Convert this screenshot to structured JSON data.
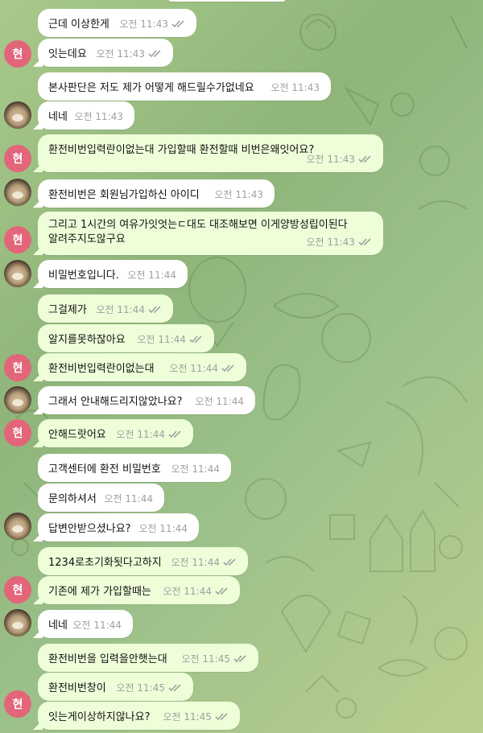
{
  "avatars": {
    "hyun": "현"
  },
  "colors": {
    "outgoing_bubble": "#eefed9",
    "incoming_bubble": "#ffffff",
    "read_check": "#5fa24c",
    "avatar_hyun": "#e2657a"
  },
  "messages": [
    {
      "id": "m1",
      "dir": "in",
      "text": "근데 이상한게",
      "time": "오전 11:43"
    },
    {
      "id": "m2",
      "dir": "in",
      "text": "잇는데요",
      "time": "오전 11:43"
    },
    {
      "id": "m3",
      "dir": "out",
      "text": "본사판단은 저도 제가 어떻게 해드릴수가없네요",
      "time": "오전 11:43"
    },
    {
      "id": "m4",
      "dir": "out",
      "text": "네네",
      "time": "오전 11:43"
    },
    {
      "id": "m5",
      "dir": "in",
      "text": "환전비번입력란이없는대 가입할때 환전할때 비번은왜잇어요?",
      "time": "오전 11:43"
    },
    {
      "id": "m6",
      "dir": "out",
      "text": "환전비번은 회원님가입하신 아이디",
      "time": "오전 11:43"
    },
    {
      "id": "m7",
      "dir": "in",
      "line1": "그리고 1시간의 여유가잇엇는ㄷ대도  대조해보면 이게양방성립이된다",
      "line2": "알려주지도않구요",
      "time": "오전 11:43"
    },
    {
      "id": "m8",
      "dir": "out",
      "text": "비밀번호입니다.",
      "time": "오전 11:44"
    },
    {
      "id": "m9",
      "dir": "in",
      "text": "그걸제가",
      "time": "오전 11:44"
    },
    {
      "id": "m10",
      "dir": "in",
      "text": "알지를못하잖아요",
      "time": "오전 11:44"
    },
    {
      "id": "m11",
      "dir": "in",
      "text": "환전비번입력란이없는대",
      "time": "오전 11:44"
    },
    {
      "id": "m12",
      "dir": "out",
      "text": "그래서 안내해드리지않았나요?",
      "time": "오전 11:44"
    },
    {
      "id": "m13",
      "dir": "in",
      "text": "안해드랏어요",
      "time": "오전 11:44"
    },
    {
      "id": "m14",
      "dir": "out",
      "text": "고객센터에 환전 비밀번호",
      "time": "오전 11:44"
    },
    {
      "id": "m15",
      "dir": "out",
      "text": "문의하셔서",
      "time": "오전 11:44"
    },
    {
      "id": "m16",
      "dir": "out",
      "text": "답변안받으셨나요?",
      "time": "오전 11:44"
    },
    {
      "id": "m17",
      "dir": "in",
      "text": "1234로초기화됫다고하지",
      "time": "오전 11:44"
    },
    {
      "id": "m18",
      "dir": "in",
      "text": "기존에 제가 가입할때는",
      "time": "오전 11:44"
    },
    {
      "id": "m19",
      "dir": "out",
      "text": "네네",
      "time": "오전 11:44"
    },
    {
      "id": "m20",
      "dir": "in",
      "text": "환전비번을 입력을안햇는대",
      "time": "오전 11:45"
    },
    {
      "id": "m21",
      "dir": "in",
      "text": "환전비번창이",
      "time": "오전 11:45"
    },
    {
      "id": "m22",
      "dir": "in",
      "text": "잇는게이상하지않나요?",
      "time": "오전 11:45"
    }
  ]
}
